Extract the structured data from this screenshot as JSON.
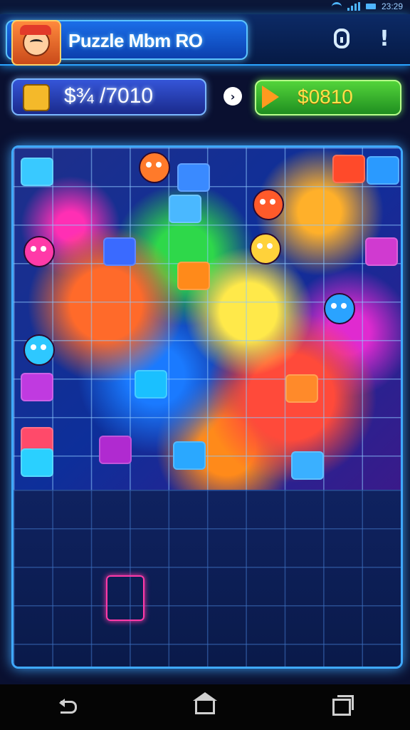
{
  "status": {
    "time": "23:29"
  },
  "header": {
    "title": "Puzzle Mbm RO",
    "icons": [
      "lock-icon",
      "alert-icon"
    ],
    "alert_glyph": "!"
  },
  "currency": {
    "coins": "$¾ /7010",
    "arrow_glyph": "›",
    "play_label": "$0810"
  },
  "colors": {
    "accent": "#3fa9ff",
    "coin_pill": "#3555d8",
    "play_pill": "#53d43a",
    "play_text": "#ffe14a",
    "board_bg": "#0b1d55"
  }
}
